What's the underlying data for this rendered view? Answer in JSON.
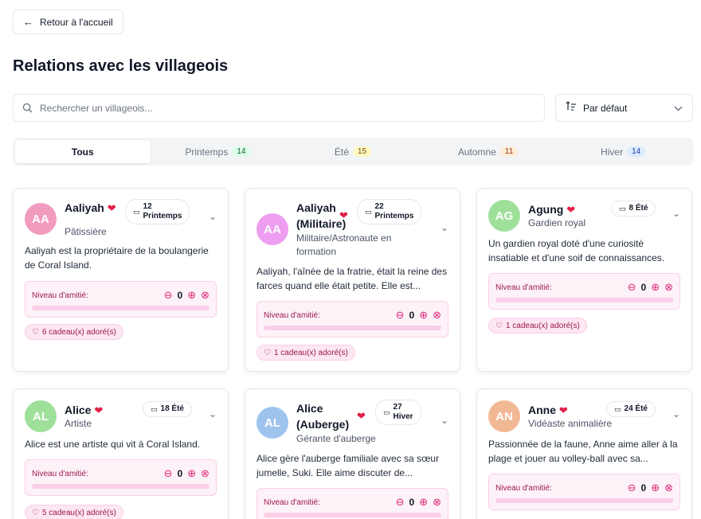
{
  "nav": {
    "back_label": "Retour à l'accueil"
  },
  "page": {
    "title": "Relations avec les villageois"
  },
  "search": {
    "placeholder": "Rechercher un villageois..."
  },
  "sort": {
    "label": "Par défaut"
  },
  "tabs": [
    {
      "label": "Tous",
      "count": null
    },
    {
      "label": "Printemps",
      "count": "14"
    },
    {
      "label": "Été",
      "count": "15"
    },
    {
      "label": "Automne",
      "count": "11"
    },
    {
      "label": "Hiver",
      "count": "14"
    }
  ],
  "colors": {
    "spring_badge": "#dcfce7",
    "summer_badge": "#fef9c3",
    "autumn_badge": "#ffedd5",
    "winter_badge": "#dbeafe",
    "heart": "#e11d48",
    "friendship_bg": "#fdf2f8"
  },
  "friendship_label": "Niveau d'amitié:",
  "villagers": [
    {
      "initials": "AA",
      "avatar_color": "#f29bbf",
      "name": "Aaliyah",
      "role": "Pâtissière",
      "birthday_day": "12",
      "birthday_season": "Printemps",
      "description": "Aaliyah est la propriétaire de la boulangerie de Coral Island.",
      "friendship_level": "0",
      "friendship_progress": 0,
      "gifts": "6 cadeau(x) adoré(s)"
    },
    {
      "initials": "AA",
      "avatar_color": "#ee9ef0",
      "name": "Aaliyah (Militaire)",
      "role": "Militaire/Astronaute en formation",
      "birthday_day": "22",
      "birthday_season": "Printemps",
      "description": "Aaliyah, l'aînée de la fratrie, était la reine des farces quand elle était petite. Elle est...",
      "friendship_level": "0",
      "friendship_progress": 0,
      "gifts": "1 cadeau(x) adoré(s)"
    },
    {
      "initials": "AG",
      "avatar_color": "#9ee09a",
      "name": "Agung",
      "role": "Gardien royal",
      "birthday_day": "8",
      "birthday_season": "Été",
      "description": "Un gardien royal doté d'une curiosité insatiable et d'une soif de connaissances.",
      "friendship_level": "0",
      "friendship_progress": 0,
      "gifts": "1 cadeau(x) adoré(s)"
    },
    {
      "initials": "AL",
      "avatar_color": "#9ee09a",
      "name": "Alice",
      "role": "Artiste",
      "birthday_day": "18",
      "birthday_season": "Été",
      "description": "Alice est une artiste qui vit à Coral Island.",
      "friendship_level": "0",
      "friendship_progress": 0,
      "gifts": "5 cadeau(x) adoré(s)"
    },
    {
      "initials": "AL",
      "avatar_color": "#9ec4ee",
      "name": "Alice (Auberge)",
      "role": "Gérante d'auberge",
      "birthday_day": "27",
      "birthday_season": "Hiver",
      "description": "Alice gère l'auberge familiale avec sa sœur jumelle, Suki. Elle aime discuter de...",
      "friendship_level": "0",
      "friendship_progress": 0,
      "gifts": ""
    },
    {
      "initials": "AN",
      "avatar_color": "#f2b894",
      "name": "Anne",
      "role": "Vidéaste animalière",
      "birthday_day": "24",
      "birthday_season": "Été",
      "description": "Passionnée de la faune, Anne aime aller à la plage et jouer au volley-ball avec sa...",
      "friendship_level": "0",
      "friendship_progress": 0,
      "gifts": ""
    }
  ]
}
